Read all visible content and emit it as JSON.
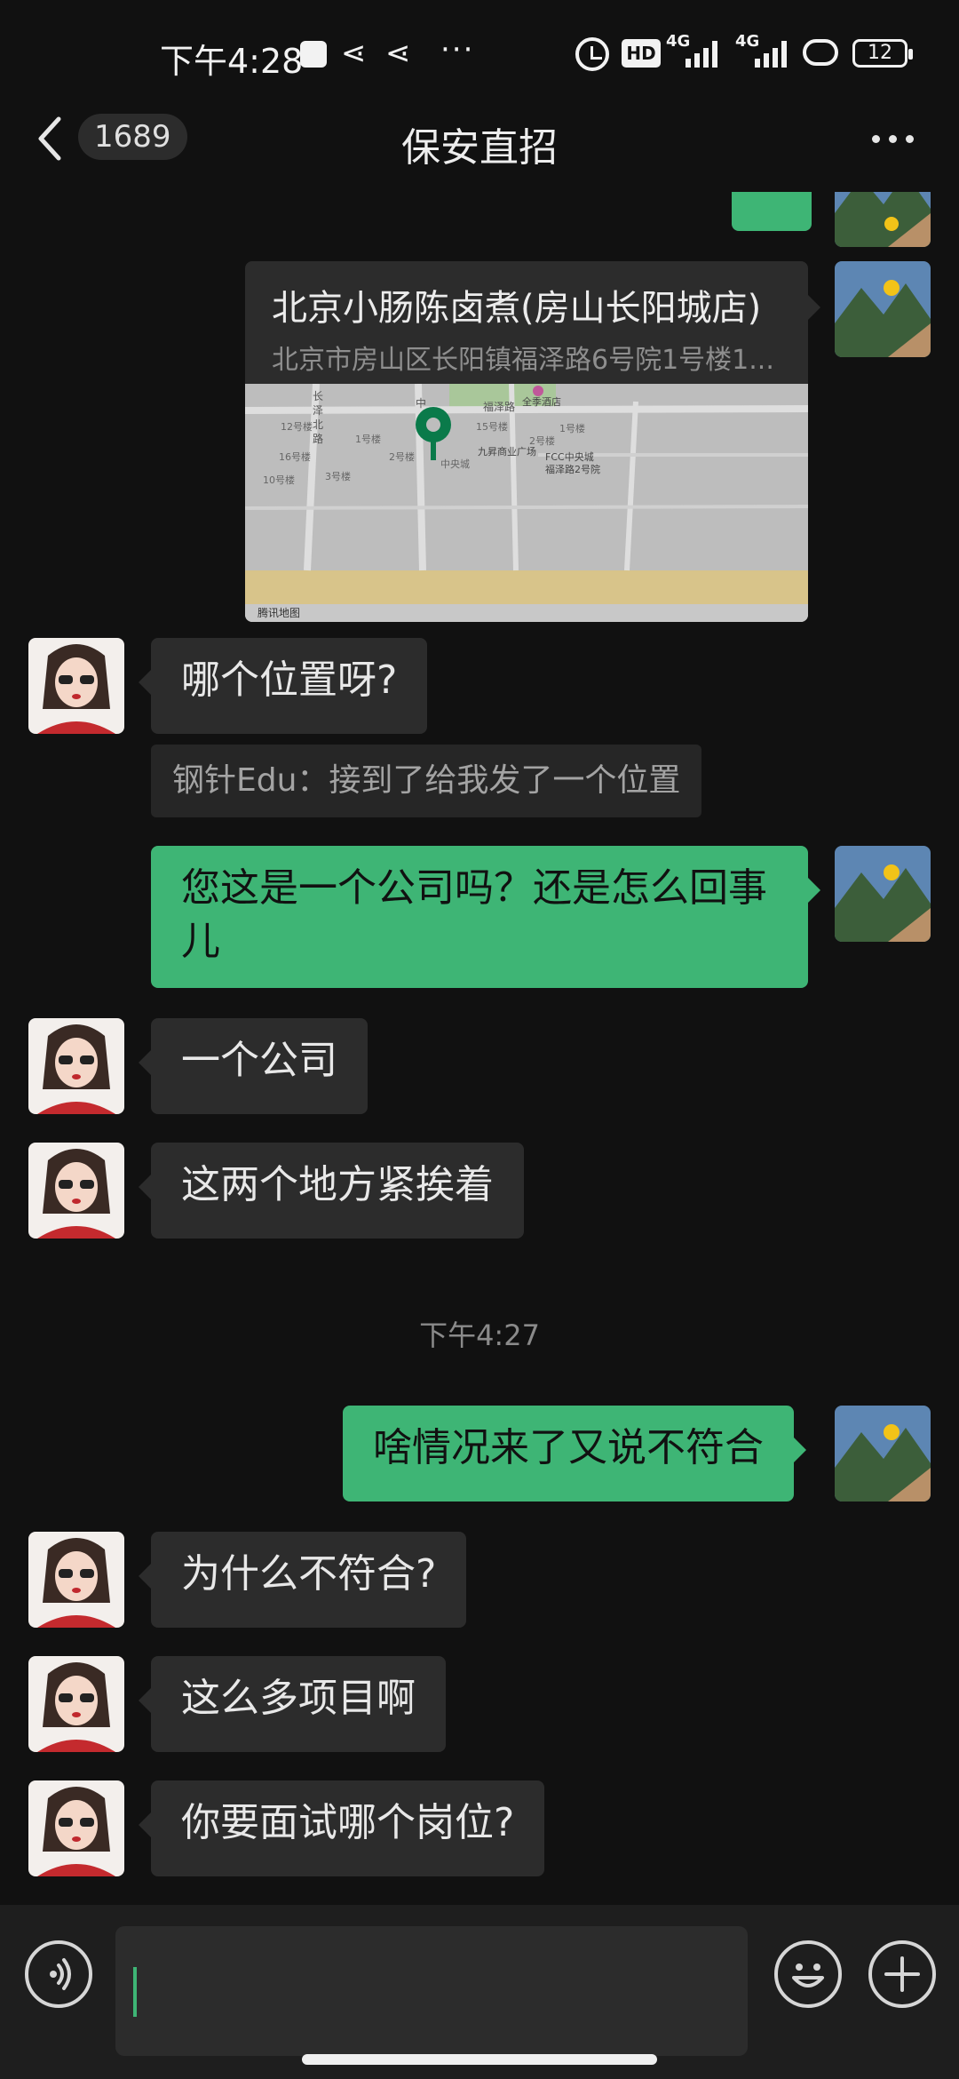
{
  "status_bar": {
    "time": "下午4:28",
    "network_1": "4G",
    "network_2": "4G",
    "hd_label": "HD",
    "battery": "12"
  },
  "header": {
    "unread_count": "1689",
    "title": "保安直招",
    "back_icon": "chevron-left-icon",
    "more_icon": "more-horizontal-icon"
  },
  "messages": [
    {
      "type": "location",
      "direction": "out",
      "place_name": "北京小肠陈卤煮(房山长阳城店)",
      "address": "北京市房山区长阳镇福泽路6号院1号楼1...",
      "map_labels": [
        "长",
        "泽",
        "北",
        "路",
        "中",
        "福泽路",
        "全季酒店",
        "12号楼",
        "1号楼",
        "15号楼",
        "2号楼",
        "1号楼",
        "16号楼",
        "2号楼",
        "九昇商业广场",
        "FCC中央城",
        "福泽路2号院",
        "10号楼",
        "3号楼",
        "中央城"
      ],
      "map_brand": "腾讯地图"
    },
    {
      "type": "text",
      "direction": "in",
      "text": "哪个位置呀?"
    },
    {
      "type": "quote",
      "text": "钢针Edu：接到了给我发了一个位置"
    },
    {
      "type": "text",
      "direction": "out",
      "text": "您这是一个公司吗？还是怎么回事儿"
    },
    {
      "type": "text",
      "direction": "in",
      "text": "一个公司"
    },
    {
      "type": "text",
      "direction": "in",
      "text": "这两个地方紧挨着"
    },
    {
      "type": "time",
      "text": "下午4:27"
    },
    {
      "type": "text",
      "direction": "out",
      "text": "啥情况来了又说不符合"
    },
    {
      "type": "text",
      "direction": "in",
      "text": "为什么不符合?"
    },
    {
      "type": "text",
      "direction": "in",
      "text": "这么多项目啊"
    },
    {
      "type": "text",
      "direction": "in",
      "text": "你要面试哪个岗位?"
    }
  ],
  "input_bar": {
    "voice_icon": "voice-icon",
    "emoji_icon": "emoji-icon",
    "plus_icon": "plus-icon",
    "value": ""
  },
  "colors": {
    "background": "#111111",
    "incoming_bubble": "#2c2c2c",
    "outgoing_bubble": "#3eb575",
    "map_pin": "#0a7a4a"
  }
}
